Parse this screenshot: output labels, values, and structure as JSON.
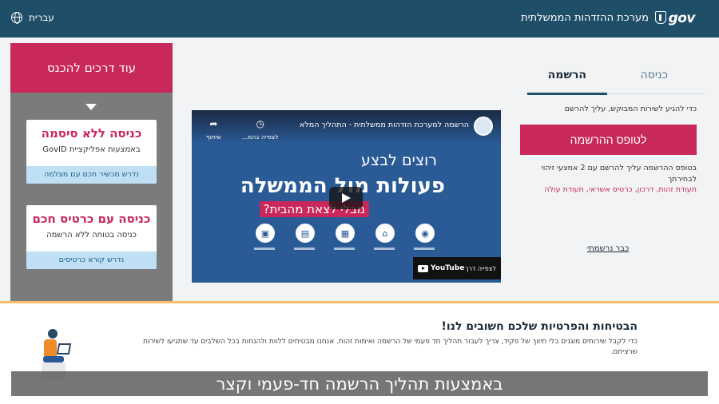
{
  "header": {
    "logo": "gov",
    "site_title": "מערכת ההזדהות הממשלתית",
    "language": "עברית"
  },
  "left_panel": {
    "heading": "עוד דרכים להכנס",
    "cards": [
      {
        "title": "כניסה ללא סיסמה",
        "subtitle": "באמצעות אפליקציית GovID",
        "footer": "נדרש מכשיר חכם עם מצלמה"
      },
      {
        "title": "כניסה עם כרטיס חכם",
        "subtitle": "כניסה בטוחה ללא הרשמה",
        "footer": "נדרש קורא כרטיסים"
      }
    ]
  },
  "tabs": {
    "register": "הרשמה",
    "login": "כניסה"
  },
  "register": {
    "prompt": "כדי להגיע לשירות המבוקש, עליך להרשם",
    "button": "לטופס ההרשמה",
    "info": "בטופס ההרשמה עליך להרשם עם 2 אמצעי זיהוי לבחירתך",
    "docs": "תעודת זהות, דרכון, כרטיס אשראי, תעודת עולה",
    "already": "כבר נרשמתי"
  },
  "video": {
    "title": "הרשמה למערכת הזדהות ממשלתית - התהליך המלא",
    "share": "שיתוף",
    "watch_later": "לצפייה בהמ...",
    "line1": "רוצים לבצע",
    "line2": "פעולות מול הממשלה",
    "line3": "מבלי לצאת מהבית?",
    "youtube_label": "YouTube",
    "watch_on": "לצפייה דרך"
  },
  "security": {
    "title": "הבטיחות והפרטיות שלכם חשובים לנו!",
    "body": "כדי לקבל שירותים מוגנים בלי תיווך של פקיד, צריך לעבור תהליך חד פעמי של הרשמה ואימות זהות. אנחנו מבטיחים ללוות ולהנחות בכל השלבים עד שתגיעו לשירות שרציתם."
  },
  "subtitle": "באמצעות תהליך הרשמה חד-פעמי וקצר"
}
